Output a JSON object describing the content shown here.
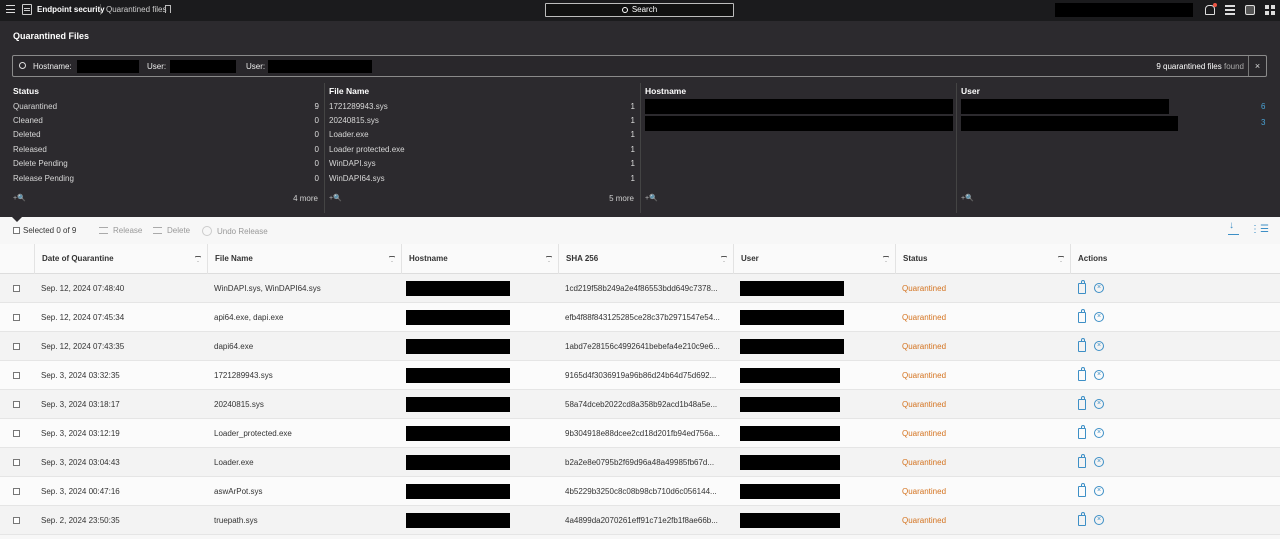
{
  "topbar": {
    "app_name": "Endpoint security",
    "breadcrumb": "Quarantined files",
    "search_label": "Search"
  },
  "panel": {
    "title": "Quarantined Files",
    "filter": {
      "hostname_label": "Hostname:",
      "user_label_1": "User:",
      "user_label_2": "User:",
      "count_text": "9 quarantined files",
      "found_text": "found",
      "clear": "×"
    },
    "facets": {
      "status": {
        "header": "Status",
        "rows": [
          {
            "label": "Quarantined",
            "count": "9"
          },
          {
            "label": "Cleaned",
            "count": "0"
          },
          {
            "label": "Deleted",
            "count": "0"
          },
          {
            "label": "Released",
            "count": "0"
          },
          {
            "label": "Delete Pending",
            "count": "0"
          },
          {
            "label": "Release Pending",
            "count": "0"
          }
        ],
        "more": "4 more",
        "add": "+🔍"
      },
      "file_name": {
        "header": "File Name",
        "rows": [
          {
            "label": "1721289943.sys",
            "count": "1"
          },
          {
            "label": "20240815.sys",
            "count": "1"
          },
          {
            "label": "Loader.exe",
            "count": "1"
          },
          {
            "label": "Loader protected.exe",
            "count": "1"
          },
          {
            "label": "WinDAPI.sys",
            "count": "1"
          },
          {
            "label": "WinDAPI64.sys",
            "count": "1"
          }
        ],
        "more": "5 more",
        "add": "+🔍"
      },
      "hostname": {
        "header": "Hostname",
        "add": "+🔍"
      },
      "user": {
        "header": "User",
        "counts": [
          "6",
          "3"
        ],
        "add": "+🔍"
      }
    }
  },
  "toolbar": {
    "selected": "Selected 0 of 9",
    "release": "Release",
    "delete": "Delete",
    "undo_release": "Undo Release"
  },
  "table": {
    "columns": [
      "Date of Quarantine",
      "File Name",
      "Hostname",
      "SHA 256",
      "User",
      "Status",
      "Actions"
    ],
    "rows": [
      {
        "date": "Sep. 12, 2024 07:48:40",
        "file": "WinDAPI.sys, WinDAPI64.sys",
        "sha": "1cd219f58b249a2e4f86553bdd649c7378...",
        "status": "Quarantined"
      },
      {
        "date": "Sep. 12, 2024 07:45:34",
        "file": "api64.exe, dapi.exe",
        "sha": "efb4f88f843125285ce28c37b2971547e54...",
        "status": "Quarantined"
      },
      {
        "date": "Sep. 12, 2024 07:43:35",
        "file": "dapi64.exe",
        "sha": "1abd7e28156c4992641bebefa4e210c9e6...",
        "status": "Quarantined"
      },
      {
        "date": "Sep. 3, 2024 03:32:35",
        "file": "1721289943.sys",
        "sha": "9165d4f3036919a96b86d24b64d75d692...",
        "status": "Quarantined"
      },
      {
        "date": "Sep. 3, 2024 03:18:17",
        "file": "20240815.sys",
        "sha": "58a74dceb2022cd8a358b92acd1b48a5e...",
        "status": "Quarantined"
      },
      {
        "date": "Sep. 3, 2024 03:12:19",
        "file": "Loader_protected.exe",
        "sha": "9b304918e88dcee2cd18d201fb94ed756a...",
        "status": "Quarantined"
      },
      {
        "date": "Sep. 3, 2024 03:04:43",
        "file": "Loader.exe",
        "sha": "b2a2e8e0795b2f69d96a48a49985fb67d...",
        "status": "Quarantined"
      },
      {
        "date": "Sep. 3, 2024 00:47:16",
        "file": "aswArPot.sys",
        "sha": "4b5229b3250c8c08b98cb710d6c056144...",
        "status": "Quarantined"
      },
      {
        "date": "Sep. 2, 2024 23:50:35",
        "file": "truepath.sys",
        "sha": "4a4899da2070261eff91c71e2fb1f8ae66b...",
        "status": "Quarantined"
      }
    ]
  },
  "colors": {
    "accent": "#3d8fc6",
    "status_quarantined": "#d4731f",
    "panel_bg": "#2c2a2e"
  }
}
